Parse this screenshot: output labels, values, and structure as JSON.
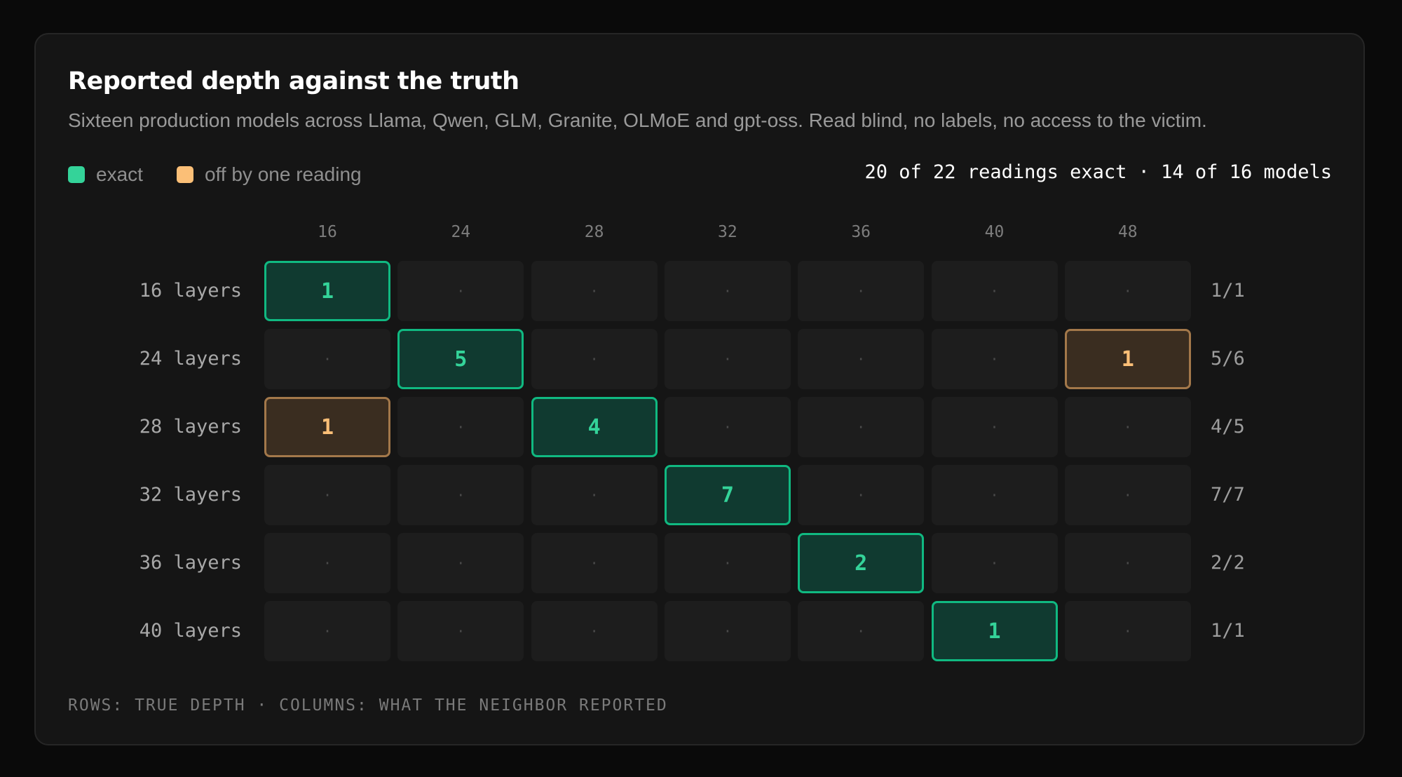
{
  "title": "Reported depth against the truth",
  "subtitle": "Sixteen production models across Llama, Qwen, GLM, Granite, OLMoE and gpt-oss. Read blind, no labels, no access to the victim.",
  "legend": {
    "exact_label": "exact",
    "off_label": "off by one reading"
  },
  "summary": "20 of 22 readings exact · 14 of 16 models",
  "footnote": "ROWS: TRUE DEPTH · COLUMNS: WHAT THE NEIGHBOR REPORTED",
  "colors": {
    "exact_border": "#10b981",
    "exact_fill": "#103a30",
    "exact_text": "#34d399",
    "off_border": "#a3784a",
    "off_fill": "#3a2d20",
    "off_text": "#fbbf77",
    "empty_fill": "#1d1d1d"
  },
  "empty_marker": "·",
  "chart_data": {
    "type": "heatmap",
    "title": "Reported depth against the truth",
    "columns": [
      "16",
      "24",
      "28",
      "32",
      "36",
      "40",
      "48"
    ],
    "rows": [
      "16 layers",
      "24 layers",
      "28 layers",
      "32 layers",
      "36 layers",
      "40 layers"
    ],
    "values": [
      [
        1,
        null,
        null,
        null,
        null,
        null,
        null
      ],
      [
        null,
        5,
        null,
        null,
        null,
        null,
        1
      ],
      [
        1,
        null,
        4,
        null,
        null,
        null,
        null
      ],
      [
        null,
        null,
        null,
        7,
        null,
        null,
        null
      ],
      [
        null,
        null,
        null,
        null,
        2,
        null,
        null
      ],
      [
        null,
        null,
        null,
        null,
        null,
        1,
        null
      ]
    ],
    "status": [
      [
        "exact",
        null,
        null,
        null,
        null,
        null,
        null
      ],
      [
        null,
        "exact",
        null,
        null,
        null,
        null,
        "off"
      ],
      [
        "off",
        null,
        "exact",
        null,
        null,
        null,
        null
      ],
      [
        null,
        null,
        null,
        "exact",
        null,
        null,
        null
      ],
      [
        null,
        null,
        null,
        null,
        "exact",
        null,
        null
      ],
      [
        null,
        null,
        null,
        null,
        null,
        "exact",
        null
      ]
    ],
    "row_totals": [
      "1/1",
      "5/6",
      "4/5",
      "7/7",
      "2/2",
      "1/1"
    ],
    "xlabel": "COLUMNS: WHAT THE NEIGHBOR REPORTED",
    "ylabel": "ROWS: TRUE DEPTH",
    "legend_position": "top-left"
  }
}
